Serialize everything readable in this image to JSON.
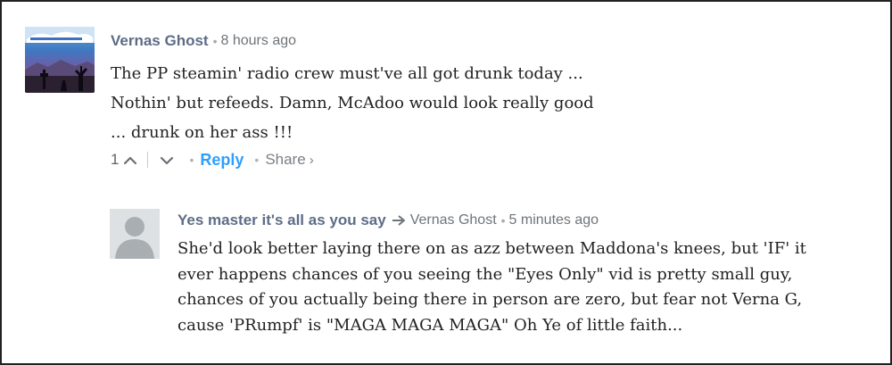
{
  "comments": [
    {
      "author": "Vernas Ghost",
      "separator": "•",
      "time": "8 hours ago",
      "avatar_icon": "desert-night-scene-avatar",
      "lines": [
        "The PP steamin' radio crew must've all got drunk today ...",
        "Nothin' but refeeds. Damn, McAdoo would look really good",
        "... drunk on her ass !!!"
      ],
      "actions": {
        "upvote_count": "1",
        "upvote_icon": "chevron-up-icon",
        "downvote_icon": "chevron-down-icon",
        "dot": "•",
        "reply_label": "Reply",
        "share_label": "Share",
        "share_chevron": "›"
      }
    }
  ],
  "reply": {
    "author": "Yes master it's all as you say",
    "reply_to_icon": "reply-arrow-icon",
    "reply_to": "Vernas Ghost",
    "separator": "•",
    "time": "5 minutes ago",
    "avatar_icon": "default-user-avatar",
    "lines": [
      "She'd look better laying there on as azz between Maddona's knees, but 'IF' it",
      "ever happens chances of you seeing the \"Eyes Only\" vid is pretty small guy,",
      "chances of you actually being there in person are zero, but fear not Verna G,",
      "cause 'PRumpf' is \"MAGA MAGA MAGA\" Oh Ye of little faith..."
    ]
  },
  "colors": {
    "author": "#5d6c87",
    "meta": "#6f7479",
    "reply_link": "#2e9fff",
    "body_text": "#222222",
    "avatar_placeholder": "#dfe3e6"
  }
}
